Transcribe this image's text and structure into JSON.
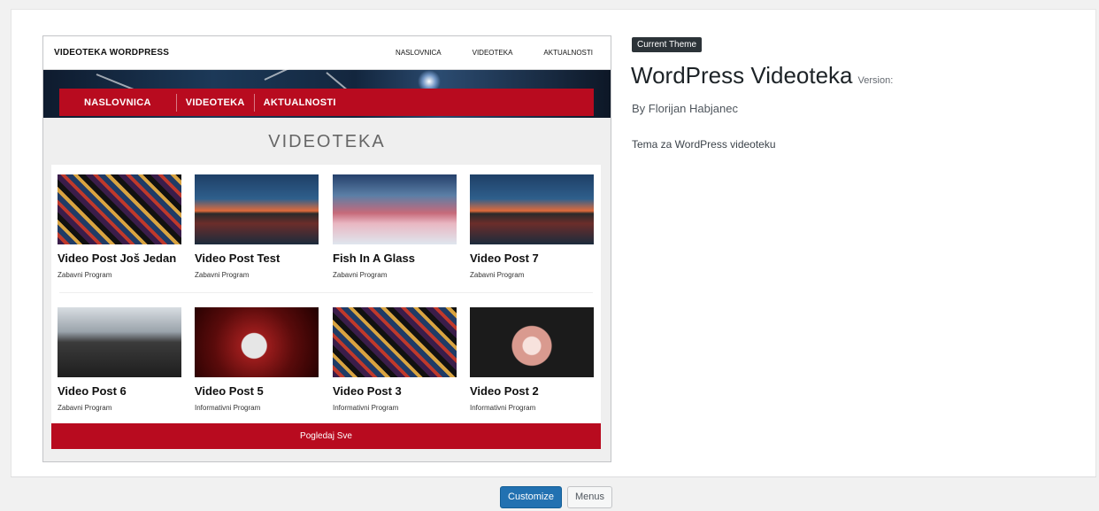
{
  "preview": {
    "site_title": "VIDEOTEKA WORDPRESS",
    "top_nav": [
      "NASLOVNICA",
      "VIDEOTEKA",
      "AKTUALNOSTI"
    ],
    "main_nav": [
      "NASLOVNICA",
      "VIDEOTEKA",
      "AKTUALNOSTI"
    ],
    "section_title": "VIDEOTEKA",
    "posts": [
      {
        "title": "Video Post Još Jedan",
        "category": "Zabavni Program",
        "thumb": "collage"
      },
      {
        "title": "Video Post Test",
        "category": "Zabavni Program",
        "thumb": "sunset-lake"
      },
      {
        "title": "Fish In A Glass",
        "category": "Zabavni Program",
        "thumb": "mountain-fog"
      },
      {
        "title": "Video Post 7",
        "category": "Zabavni Program",
        "thumb": "sunset-lake"
      },
      {
        "title": "Video Post 6",
        "category": "Zabavni Program",
        "thumb": "rail-tracks"
      },
      {
        "title": "Video Post 5",
        "category": "Informativni Program",
        "thumb": "red-sphere"
      },
      {
        "title": "Video Post 3",
        "category": "Informativni Program",
        "thumb": "collage"
      },
      {
        "title": "Video Post 2",
        "category": "Informativni Program",
        "thumb": "flowers"
      }
    ],
    "view_all_label": "Pogledaj Sve"
  },
  "theme": {
    "badge": "Current Theme",
    "name": "WordPress Videoteka",
    "version_label": "Version:",
    "author": "By Florijan Habjanec",
    "description": "Tema za WordPress videoteku"
  },
  "actions": {
    "customize_label": "Customize",
    "menus_label": "Menus"
  },
  "colors": {
    "accent_red": "#b80b1f",
    "primary_blue": "#2271b1",
    "badge_dark": "#2c3338"
  }
}
